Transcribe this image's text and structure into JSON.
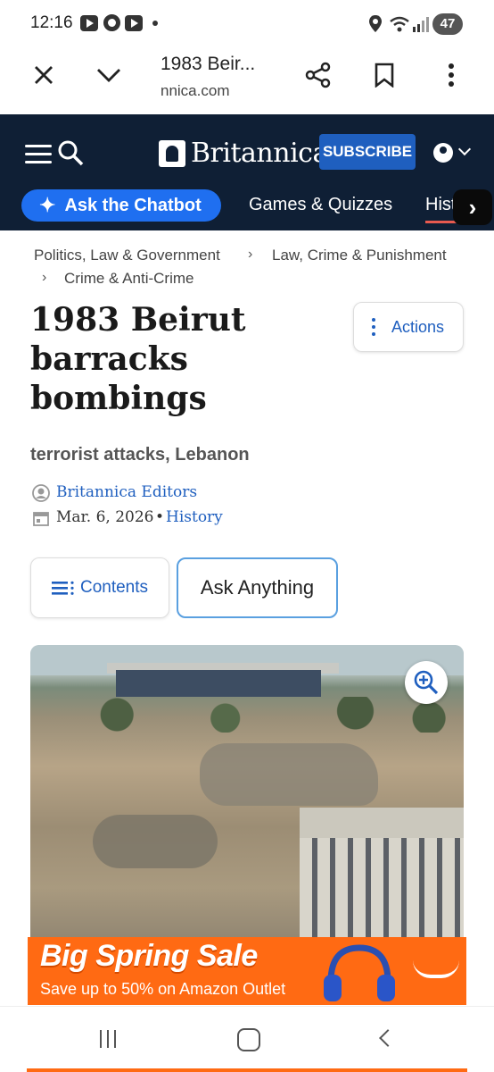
{
  "status_bar": {
    "time": "12:16",
    "battery": "47",
    "icons": [
      "youtube-icon",
      "chrome-icon",
      "youtube-icon",
      "dot-icon",
      "location-icon",
      "wifi-icon",
      "signal-icon",
      "battery-icon"
    ]
  },
  "browser": {
    "tab_title": "1983 Beir...",
    "url_host": "nnica.com",
    "icons": [
      "close-icon",
      "chevron-down-icon",
      "share-icon",
      "bookmark-icon",
      "more-vert-icon"
    ]
  },
  "site_header": {
    "logo_text": "Britannica",
    "subscribe_label": "SUBSCRIBE",
    "chatbot_label": "Ask the Chatbot",
    "nav_links": [
      "Games & Quizzes",
      "History"
    ],
    "accent_color": "#1f6ff0",
    "background_color": "#0f1f35"
  },
  "breadcrumb": {
    "items": [
      "Politics, Law & Government",
      "Law, Crime & Punishment",
      "Crime & Anti-Crime"
    ]
  },
  "article": {
    "title_lines": [
      "1983 Beirut",
      "barracks",
      "bombings"
    ],
    "actions_label": "Actions",
    "subtitle": "terrorist attacks, Lebanon",
    "author": "Britannica Editors",
    "date": "Mar. 6, 2026",
    "bullet": "•",
    "category": "History",
    "contents_label": "Contents",
    "ask_label": "Ask Anything"
  },
  "ad": {
    "headline": "Big Spring Sale",
    "subline": "Save up to 50% on Amazon Outlet",
    "color": "#ff6a13"
  }
}
